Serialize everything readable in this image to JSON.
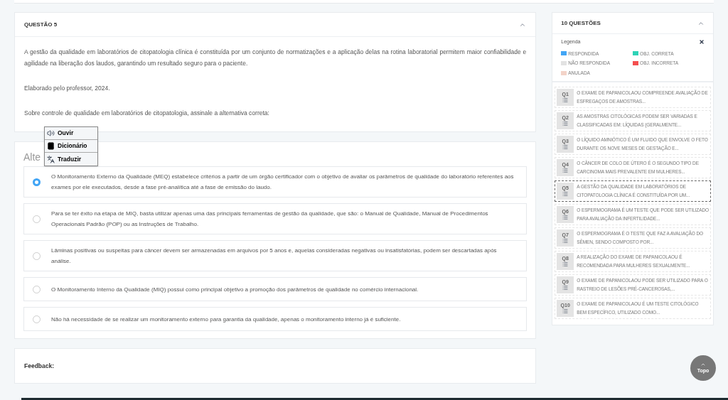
{
  "question": {
    "title": "QUESTÃO 5",
    "paragraphs": [
      "A gestão da qualidade em laboratórios de citopatologia clínica é constituída por um conjunto de normatizações e a aplicação delas na rotina laboratorial permitem maior confiabilidade e agilidade na liberação dos laudos, garantindo um resultado seguro para o paciente.",
      "Elaborado pelo professor, 2024.",
      "Sobre controle de qualidade em laboratórios de citopatologia, assinale a alternativa correta:"
    ]
  },
  "popup_menu": [
    {
      "kind": "speaker",
      "label": "Ouvir"
    },
    {
      "kind": "book",
      "label": "Dicionário"
    },
    {
      "kind": "translate",
      "label": "Traduzir"
    }
  ],
  "alternatives": {
    "heading": "Alte",
    "options": [
      {
        "text": "O Monitoramento Externo da Qualidade (MEQ) estabelece critérios a partir de um órgão certificador com o objetivo de avaliar os parâmetros de qualidade do laboratório referentes aos exames por ele executados, desde a fase pré-analítica até a fase de emissão do laudo.",
        "selected": true
      },
      {
        "text": "Para se ter êxito na etapa de MIQ, basta utilizar apenas uma das principais ferramentas de gestão da qualidade, que são: o Manual de Qualidade, Manual de Procedimentos Operacionais Padrão (POP) ou as Instruções de Trabalho.",
        "selected": false
      },
      {
        "text": "Lâminas positivas ou suspeitas para câncer devem ser armazenadas em arquivos por 5 anos e, aquelas consideradas negativas ou insatisfatórias, podem ser descartadas após análise.",
        "selected": false
      },
      {
        "text": "O Monitoramento Interno da Qualidade (MIQ) possui como principal objetivo a promoção dos parâmetros de qualidade no comércio internacional.",
        "selected": false
      },
      {
        "text": "Não há necessidade de se realizar um monitoramento externo para garantia da qualidade, apenas o monitoramento interno já é suficiente.",
        "selected": false
      }
    ]
  },
  "feedback": {
    "label": "Feedback:"
  },
  "sidebar": {
    "title": "10 QUESTÕES",
    "legend": {
      "title": "Legenda",
      "items": [
        {
          "label": "RESPONDIDA",
          "color": "#42a5f5"
        },
        {
          "label": "OBJ. CORRETA",
          "color": "#2ed3b7"
        },
        {
          "label": "NÃO RESPONDIDA",
          "color": "#e2e2e2"
        },
        {
          "label": "OBJ. INCORRETA",
          "color": "#f44f4f"
        },
        {
          "label": "ANULADA",
          "color": "#f3d3c8"
        }
      ]
    },
    "questions": [
      {
        "number": "Q1",
        "text": "O EXAME DE PAPANICOLAOU COMPREENDE AVALIAÇÃO DE ESFREGAÇOS DE AMOSTRAS...",
        "selected": false
      },
      {
        "number": "Q2",
        "text": "AS AMOSTRAS CITOLÓGICAS PODEM SER VARIADAS E CLASSIFICADAS EM: LÍQUIDAS (GERALMENTE...",
        "selected": false
      },
      {
        "number": "Q3",
        "text": "O LÍQUIDO AMNIÓTICO É UM FLUIDO QUE ENVOLVE O FETO DURANTE OS NOVE MESES DE GESTAÇÃO E...",
        "selected": false
      },
      {
        "number": "Q4",
        "text": "O CÂNCER DE COLO DE ÚTERO É O SEGUNDO TIPO DE CARCINOMA MAIS PREVALENTE EM MULHERES...",
        "selected": false
      },
      {
        "number": "Q5",
        "text": "A GESTÃO DA QUALIDADE EM LABORATÓRIOS DE CITOPATOLOGIA CLÍNICA É CONSTITUÍDA POR UM...",
        "selected": true
      },
      {
        "number": "Q6",
        "text": "O ESPERMOGRAMA É UM TESTE QUE PODE SER UTILIZADO PARA AVALIAÇÃO DA INFERTILIDADE...",
        "selected": false
      },
      {
        "number": "Q7",
        "text": "O ESPERMOGRAMA É O TESTE QUE FAZ A AVALIAÇÃO DO SÊMEN, SENDO COMPOSTO POR...",
        "selected": false
      },
      {
        "number": "Q8",
        "text": "A REALIZAÇÃO DO EXAME DE PAPANICOLAOU É RECOMENDADA PARA MULHERES SEXUALMENTE...",
        "selected": false
      },
      {
        "number": "Q9",
        "text": "O EXAME DE PAPANICOLAOU PODE SER UTILIZADO PARA O RASTREIO DE LESÕES PRÉ-CANCEROSAS,...",
        "selected": false
      },
      {
        "number": "Q10",
        "text": "O EXAME DE PAPANICOLAOU É UM TESTE CITOLÓGICO BEM ESPECÍFICO, UTILIZADO COMO...",
        "selected": false
      }
    ]
  },
  "top_button": {
    "label": "Topo"
  }
}
